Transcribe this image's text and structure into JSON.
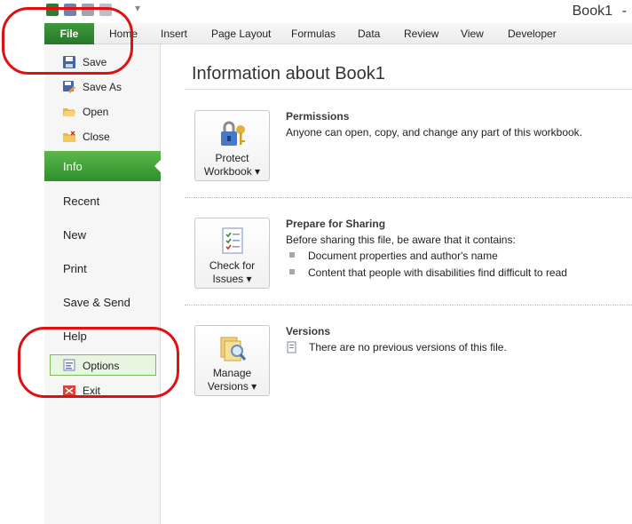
{
  "window": {
    "title": "Book1",
    "title_dash": "-"
  },
  "ribbon": {
    "file_tab": "File",
    "tabs": [
      "Home",
      "Insert",
      "Page Layout",
      "Formulas",
      "Data",
      "Review",
      "View",
      "Developer"
    ]
  },
  "backstage_nav": {
    "commands": [
      "Save",
      "Save As",
      "Open",
      "Close"
    ],
    "tabs": [
      "Info",
      "Recent",
      "New",
      "Print",
      "Save & Send",
      "Help"
    ],
    "options": "Options",
    "exit": "Exit"
  },
  "info_page": {
    "heading": "Information about Book1",
    "permissions": {
      "button_line1": "Protect",
      "button_line2": "Workbook ▾",
      "title": "Permissions",
      "description": "Anyone can open, copy, and change any part of this workbook."
    },
    "prepare": {
      "button_line1": "Check for",
      "button_line2": "Issues ▾",
      "title": "Prepare for Sharing",
      "description": "Before sharing this file, be aware that it contains:",
      "items": [
        "Document properties and author's name",
        "Content that people with disabilities find difficult to read"
      ]
    },
    "versions": {
      "button_line1": "Manage",
      "button_line2": "Versions ▾",
      "title": "Versions",
      "description": "There are no previous versions of this file."
    }
  },
  "colors": {
    "file_tab": "#2e8a2f",
    "info_tab": "#4aa63d",
    "annotation": "#e01010"
  }
}
